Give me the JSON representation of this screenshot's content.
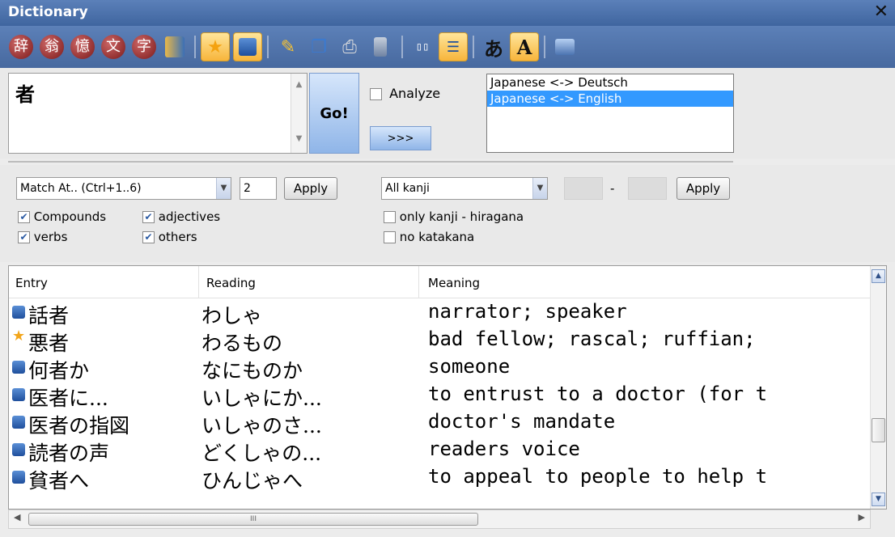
{
  "window": {
    "title": "Dictionary",
    "close_glyph": "✕"
  },
  "toolbar": {
    "kanji_buttons": [
      "辞",
      "翁",
      "憶",
      "文",
      "字"
    ],
    "text_a_label": "あ",
    "text_a2_label": "A"
  },
  "search": {
    "query": "者",
    "go_label": "Go!",
    "analyze_label": "Analyze",
    "expand_label": ">>>"
  },
  "dictionaries": [
    {
      "label": "Japanese <-> Deutsch",
      "selected": false
    },
    {
      "label": "Japanese <-> English",
      "selected": true
    }
  ],
  "filters": {
    "match_value": "Match At..  (Ctrl+1..6)",
    "match_num": "2",
    "apply_label": "Apply",
    "kanji_filter": "All kanji",
    "range_sep": "-",
    "apply2_label": "Apply",
    "compounds": "Compounds",
    "adjectives": "adjectives",
    "verbs": "verbs",
    "others": "others",
    "only_kanji": "only kanji - hiragana",
    "no_katakana": "no katakana"
  },
  "table": {
    "headers": [
      "Entry",
      "Reading",
      "Meaning"
    ],
    "rows": [
      {
        "icon": "book",
        "entry": "話者",
        "reading": "わしゃ",
        "meaning": "narrator; speaker"
      },
      {
        "icon": "star",
        "entry": "悪者",
        "reading": "わるもの",
        "meaning": "bad fellow; rascal; ruffian;"
      },
      {
        "icon": "book",
        "entry": "何者か",
        "reading": "なにものか",
        "meaning": "someone"
      },
      {
        "icon": "book",
        "entry": "医者に...",
        "reading": "いしゃにか...",
        "meaning": "to entrust to a doctor (for t"
      },
      {
        "icon": "book",
        "entry": "医者の指図",
        "reading": "いしゃのさ...",
        "meaning": "doctor's mandate"
      },
      {
        "icon": "book",
        "entry": "読者の声",
        "reading": "どくしゃの...",
        "meaning": "readers voice"
      },
      {
        "icon": "book",
        "entry": "貧者へ",
        "reading": "ひんじゃへ",
        "meaning": "to appeal to people to help t"
      }
    ]
  },
  "hscroll": {
    "grip": "III"
  }
}
